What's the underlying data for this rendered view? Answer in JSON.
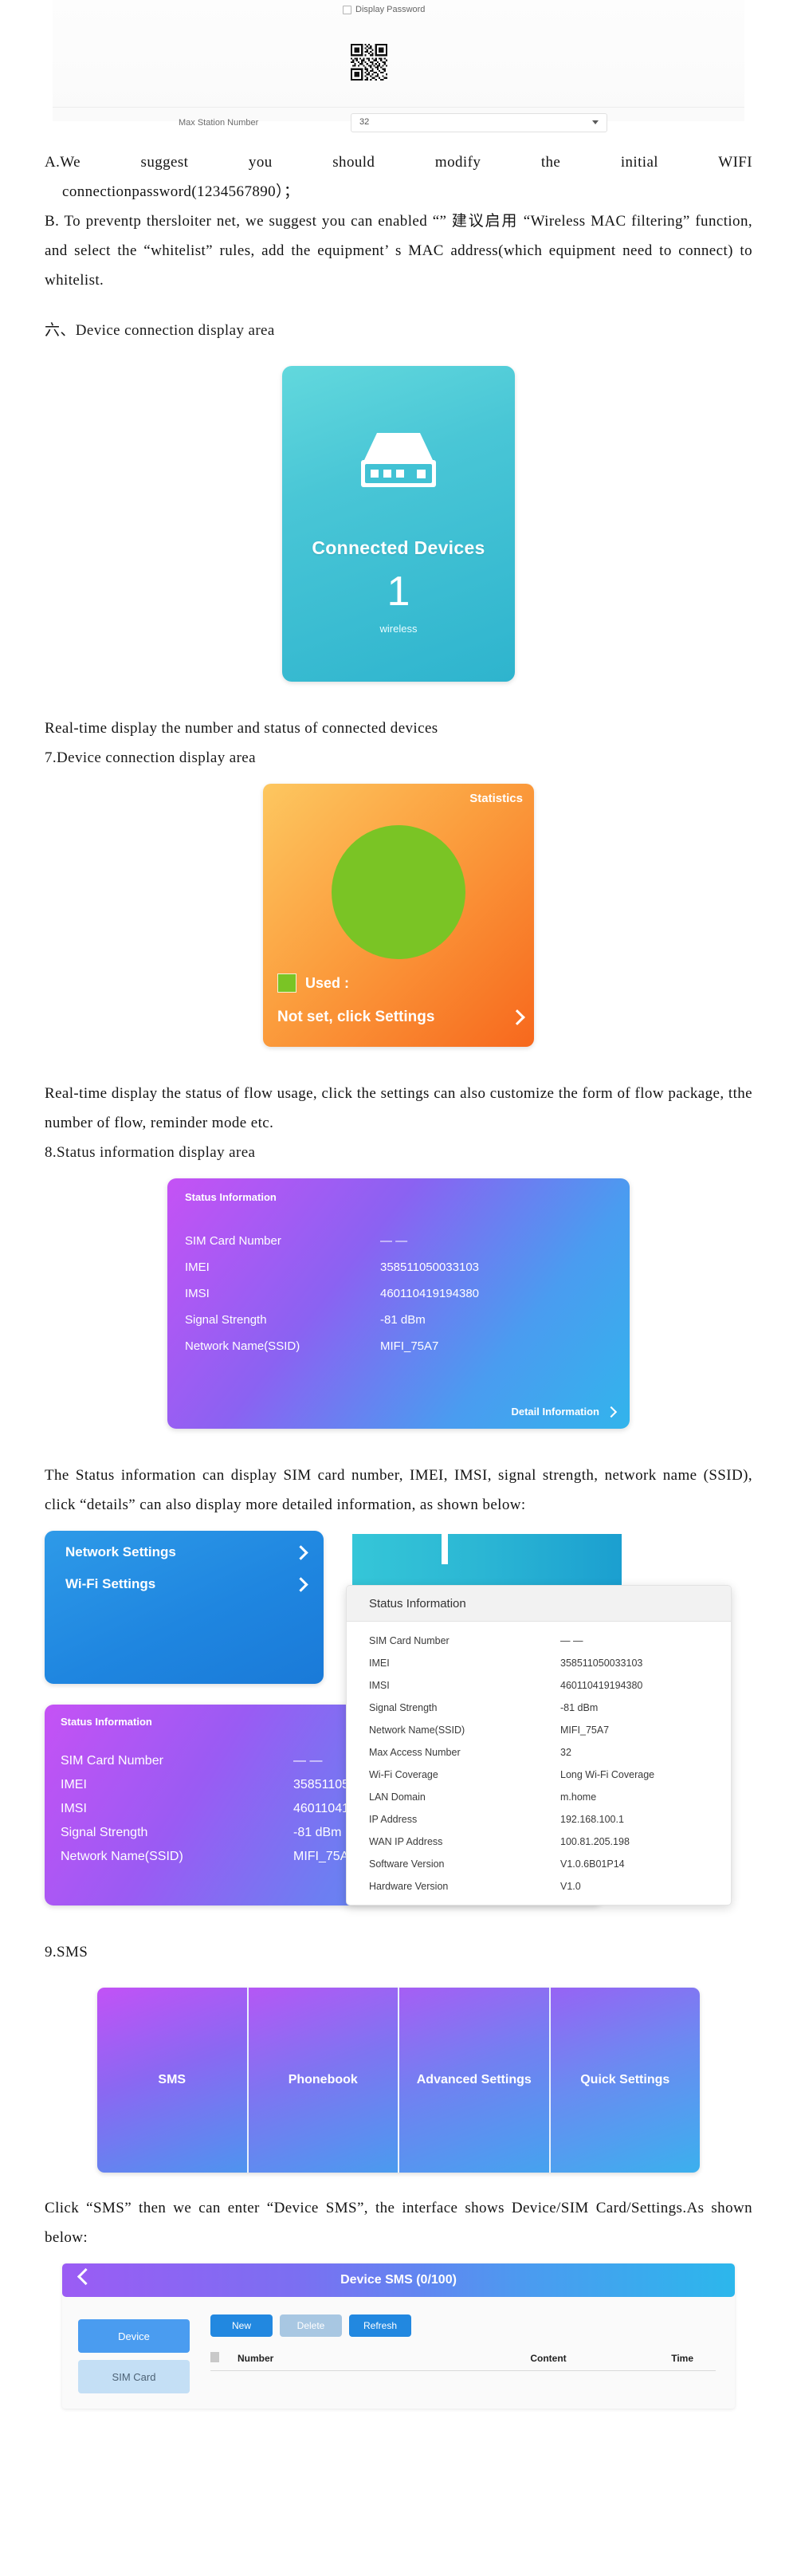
{
  "top_screenshot": {
    "display_password_label": "Display Password",
    "max_station_number_label": "Max Station Number",
    "max_station_number_value": "32"
  },
  "notes": {
    "item_a_line1": "A.We suggest you should modify the initial WIFI",
    "item_a_line2": "connectionpassword(1234567890）；",
    "item_b": "B. To preventp thersloiter net, we suggest you can enabled “” 建议启用 “Wireless MAC filtering” function, and select the “whitelist” rules, add the equipment’ s MAC address(which equipment need to connect) to whitelist."
  },
  "sections": {
    "six_heading": "六、Device connection display area",
    "six_caption": "Real-time display the number and status of connected devices",
    "seven_heading": "7.Device connection display area",
    "seven_caption": "Real-time display the status of flow usage, click the settings can also customize the form of flow package, tthe number of flow, reminder mode etc.",
    "eight_heading": "8.Status information display area",
    "eight_caption": "The Status information can display SIM card number, IMEI, IMSI, signal strength, network name (SSID), click “details” can also display more detailed information, as shown below:",
    "nine_heading": "9.SMS",
    "nine_caption": "Click “SMS” then we can enter “Device SMS”, the interface shows Device/SIM Card/Settings.As shown below:"
  },
  "connected_devices_card": {
    "title": "Connected Devices",
    "count": "1",
    "subtitle": "wireless",
    "icon": "router-icon",
    "gradient_from": "#62d8dd",
    "gradient_to": "#2eb4ce"
  },
  "statistics_card": {
    "title": "Statistics",
    "legend_label": "Used  :",
    "legend_value": "",
    "footer_label": "Not set, click Settings",
    "chevron": "chevron-right-icon",
    "donut_color": "#7ac425",
    "gradient_from": "#fdc760",
    "gradient_to": "#f7681d"
  },
  "status_card": {
    "header": "Status Information",
    "rows": [
      {
        "key": "SIM Card Number",
        "value": "— —"
      },
      {
        "key": "IMEI",
        "value": "358511050033103"
      },
      {
        "key": "IMSI",
        "value": "460110419194380"
      },
      {
        "key": "Signal Strength",
        "value": "-81 dBm"
      },
      {
        "key": "Network Name(SSID)",
        "value": "MIFI_75A7"
      }
    ],
    "detail_link": "Detail Information"
  },
  "nav_card": {
    "items": [
      {
        "label": "Network Settings"
      },
      {
        "label": "Wi-Fi Settings"
      }
    ]
  },
  "detail_panel": {
    "header": "Status Information",
    "rows": [
      {
        "key": "SIM Card Number",
        "value": "— —"
      },
      {
        "key": "IMEI",
        "value": "358511050033103"
      },
      {
        "key": "IMSI",
        "value": "460110419194380"
      },
      {
        "key": "Signal Strength",
        "value": "-81 dBm"
      },
      {
        "key": "Network Name(SSID)",
        "value": "MIFI_75A7"
      },
      {
        "key": "Max Access Number",
        "value": "32"
      },
      {
        "key": "Wi-Fi Coverage",
        "value": "Long Wi-Fi Coverage"
      },
      {
        "key": "LAN Domain",
        "value": "m.home"
      },
      {
        "key": "IP Address",
        "value": "192.168.100.1"
      },
      {
        "key": "WAN IP Address",
        "value": "100.81.205.198"
      },
      {
        "key": "Software Version",
        "value": "V1.0.6B01P14"
      },
      {
        "key": "Hardware Version",
        "value": "V1.0"
      }
    ]
  },
  "sms_tiles": [
    {
      "label": "SMS"
    },
    {
      "label": "Phonebook"
    },
    {
      "label": "Advanced Settings"
    },
    {
      "label": "Quick Settings"
    }
  ],
  "sms_panel": {
    "title": "Device SMS (0/100)",
    "back_icon": "chevron-left-icon",
    "side_items": [
      {
        "label": "Device",
        "state": "active"
      },
      {
        "label": "SIM Card",
        "state": "idle"
      }
    ],
    "actions": [
      {
        "label": "New",
        "style": "primary"
      },
      {
        "label": "Delete",
        "style": "muted"
      },
      {
        "label": "Refresh",
        "style": "primary"
      }
    ],
    "columns": [
      "Number",
      "Content",
      "Time"
    ]
  }
}
